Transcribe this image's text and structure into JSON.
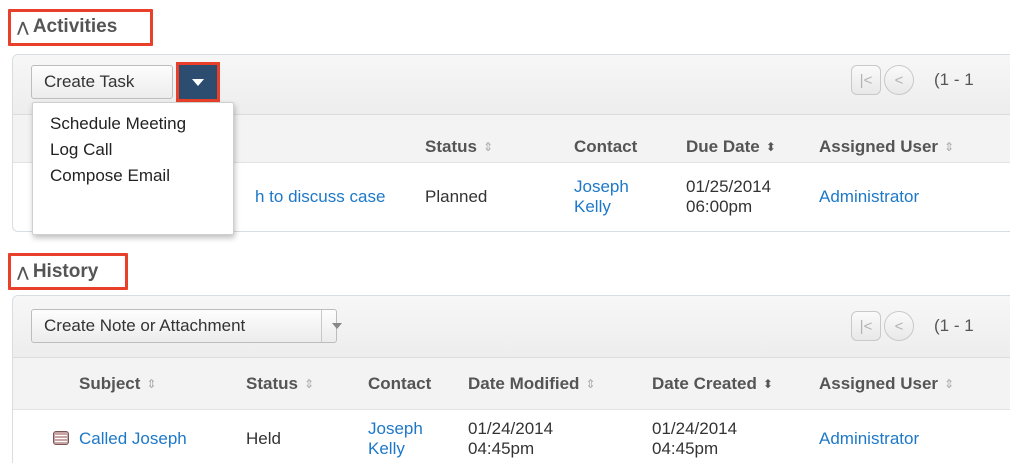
{
  "activities": {
    "title": "Activities",
    "create_button": "Create Task",
    "menu": [
      "Schedule Meeting",
      "Log Call",
      "Compose Email"
    ],
    "pager_text": "(1 - 1",
    "columns": [
      "Status",
      "Contact",
      "Due Date",
      "Assigned User"
    ],
    "row": {
      "subject_partial": "h to discuss case",
      "status": "Planned",
      "contact_first": "Joseph",
      "contact_last": "Kelly",
      "due_date": "01/25/2014",
      "due_time": "06:00pm",
      "assigned_user": "Administrator"
    }
  },
  "history": {
    "title": "History",
    "create_button": "Create Note or Attachment",
    "pager_text": "(1 - 1",
    "columns": [
      "Subject",
      "Status",
      "Contact",
      "Date Modified",
      "Date Created",
      "Assigned User"
    ],
    "row": {
      "subject": "Called Joseph",
      "status": "Held",
      "contact_first": "Joseph",
      "contact_last": "Kelly",
      "modified_date": "01/24/2014",
      "modified_time": "04:45pm",
      "created_date": "01/24/2014",
      "created_time": "04:45pm",
      "assigned_user": "Administrator"
    }
  },
  "colors": {
    "link": "#1e78c8",
    "highlight": "#e8402a",
    "split_button": "#2c4d70"
  },
  "icons": {
    "collapse": "double-chevron-up-icon",
    "first_page": "first-page-icon",
    "prev_page": "previous-page-icon",
    "call_log": "call-log-icon"
  }
}
